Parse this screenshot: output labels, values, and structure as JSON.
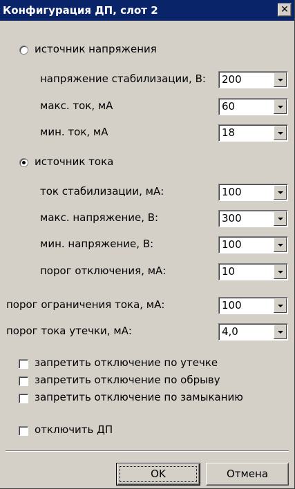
{
  "window": {
    "title": "Конфигурация ДП, слот 2",
    "close_glyph": "✕"
  },
  "voltage_source": {
    "label": "источник напряжения",
    "selected": false,
    "fields": [
      {
        "label": "напряжение стабилизации, В:",
        "value": "200"
      },
      {
        "label": "макс. ток, мА",
        "value": "60"
      },
      {
        "label": "мин. ток, мА",
        "value": "18"
      }
    ]
  },
  "current_source": {
    "label": "источник тока",
    "selected": true,
    "fields": [
      {
        "label": "ток стабилизации, мА:",
        "value": "100"
      },
      {
        "label": "макс. напряжение, В:",
        "value": "300"
      },
      {
        "label": "мин. напряжение, В:",
        "value": "100"
      },
      {
        "label": "порог отключения, мА:",
        "value": "10"
      }
    ]
  },
  "general": {
    "fields": [
      {
        "label": "порог ограничения тока, мА:",
        "value": "100"
      },
      {
        "label": "порог тока утечки, мА:",
        "value": "4,0"
      }
    ]
  },
  "checkboxes": [
    {
      "label": "запретить отключение по утечке",
      "checked": false
    },
    {
      "label": "запретить отключение по обрыву",
      "checked": false
    },
    {
      "label": "запретить отключение по замыканию",
      "checked": false
    },
    {
      "label": "отключить ДП",
      "checked": false
    }
  ],
  "buttons": {
    "ok": "OK",
    "cancel": "Отмена"
  }
}
